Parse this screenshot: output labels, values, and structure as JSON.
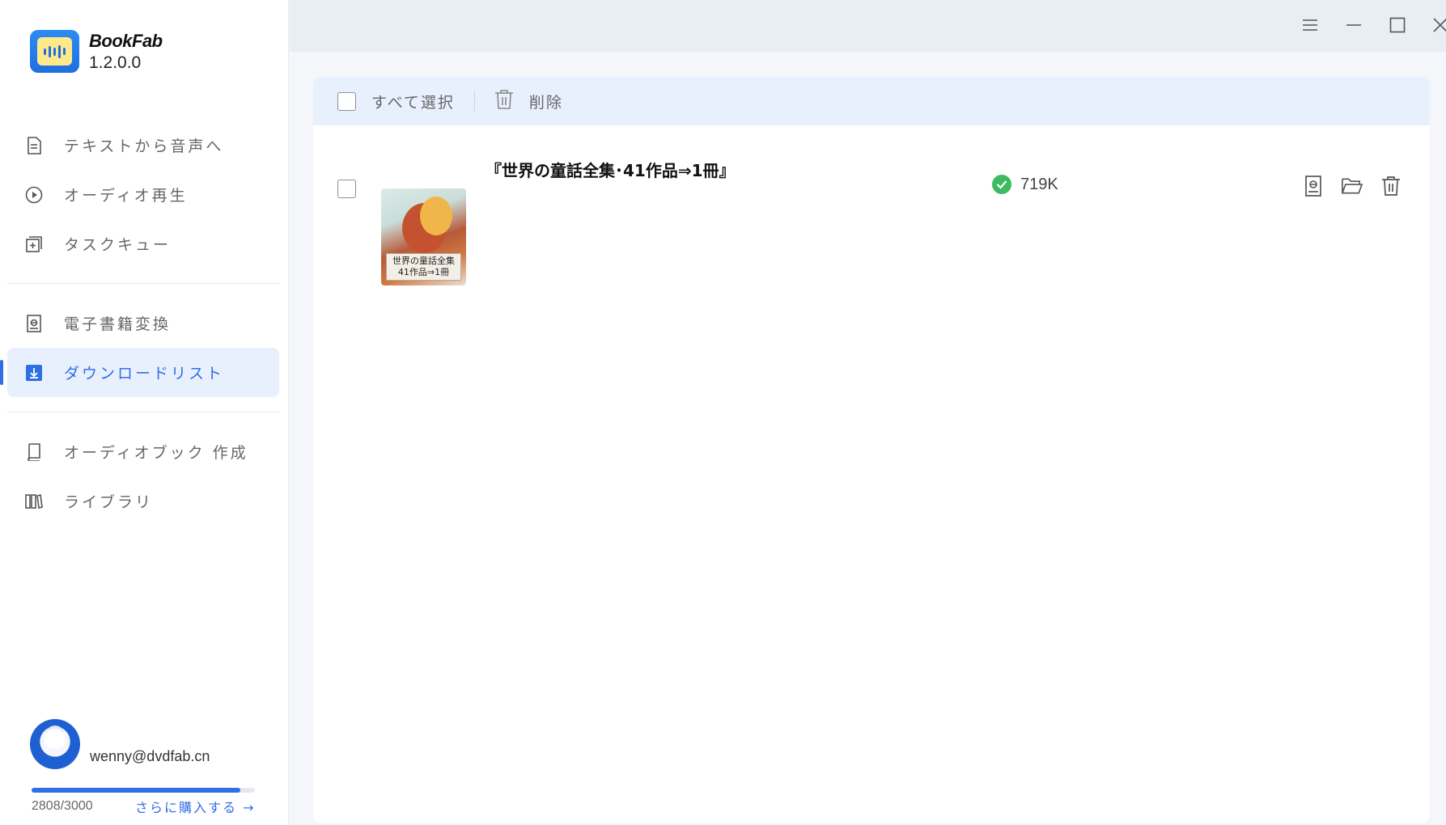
{
  "app": {
    "name": "BookFab",
    "version": "1.2.0.0"
  },
  "sidebar": {
    "items": [
      {
        "label": "テキストから音声へ",
        "icon": "document-icon"
      },
      {
        "label": "オーディオ再生",
        "icon": "play-circle-icon"
      },
      {
        "label": "タスクキュー",
        "icon": "add-queue-icon"
      },
      {
        "label": "電子書籍変換",
        "icon": "ebook-icon"
      },
      {
        "label": "ダウンロードリスト",
        "icon": "download-icon",
        "active": true
      },
      {
        "label": "オーディオブック 作成",
        "icon": "book-icon"
      },
      {
        "label": "ライブラリ",
        "icon": "library-icon"
      }
    ]
  },
  "user": {
    "email": "wenny@dvdfab.cn",
    "quota_text": "2808/3000",
    "quota_fraction": 0.936,
    "buy_label": "さらに購入する →"
  },
  "toolbar": {
    "select_all": "すべて選択",
    "delete": "削除"
  },
  "downloads": [
    {
      "title": "『世界の童話全集･41作品⇒1冊』",
      "cover_line1": "世界の童話全集",
      "cover_line2": "41作品⇒1冊",
      "size": "719K",
      "status": "completed"
    }
  ],
  "colors": {
    "accent": "#2f6fe4",
    "success": "#3dbb61",
    "active_bg": "#e8f0fe"
  }
}
